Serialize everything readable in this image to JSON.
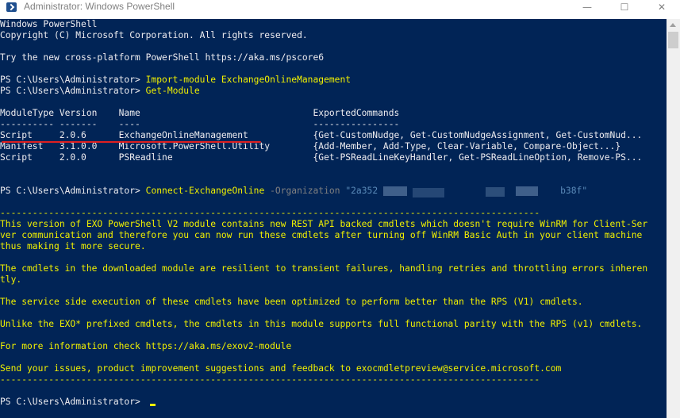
{
  "window": {
    "title": "Administrator: Windows PowerShell",
    "minimize_glyph": "—",
    "maximize_glyph": "☐",
    "close_glyph": "✕"
  },
  "console": {
    "banner": [
      "Windows PowerShell",
      "Copyright (C) Microsoft Corporation. All rights reserved."
    ],
    "tip": "Try the new cross-platform PowerShell https://aka.ms/pscore6",
    "prompt": "PS C:\\Users\\Administrator> ",
    "commands": {
      "import": "Import-module ExchangeOnlineManagement",
      "get_module": "Get-Module",
      "connect": "Connect-ExchangeOnline",
      "connect_param": " -Organization ",
      "org_start": "\"2a352",
      "org_end": "b38f\""
    },
    "module_table": {
      "header": "ModuleType Version    Name                                ExportedCommands",
      "separator": "---------- -------    ----                                ----------------",
      "rows": [
        "Script     2.0.6      ExchangeOnlineManagement            {Get-CustomNudge, Get-CustomNudgeAssignment, Get-CustomNud...",
        "Manifest   3.1.0.0    Microsoft.PowerShell.Utility        {Add-Member, Add-Type, Clear-Variable, Compare-Object...}",
        "Script     2.0.0      PSReadline                          {Get-PSReadLineKeyHandler, Get-PSReadLineOption, Remove-PS..."
      ]
    },
    "message": {
      "rule": "----------------------------------------------------------------------------------------------------",
      "lines": [
        "This version of EXO PowerShell V2 module contains new REST API backed cmdlets which doesn't require WinRM for Client-Ser",
        "ver communication and therefore you can now run these cmdlets after turning off WinRM Basic Auth in your client machine",
        "thus making it more secure.",
        "",
        "The cmdlets in the downloaded module are resilient to transient failures, handling retries and throttling errors inheren",
        "tly.",
        "",
        "The service side execution of these cmdlets have been optimized to perform better than the RPS (V1) cmdlets.",
        "",
        "Unlike the EXO* prefixed cmdlets, the cmdlets in this module supports full functional parity with the RPS (v1) cmdlets.",
        "",
        "For more information check https://aka.ms/exov2-module",
        "",
        "Send your issues, product improvement suggestions and feedback to exocmdletpreview@service.microsoft.com"
      ]
    },
    "final_prompt": "PS C:\\Users\\Administrator> "
  }
}
